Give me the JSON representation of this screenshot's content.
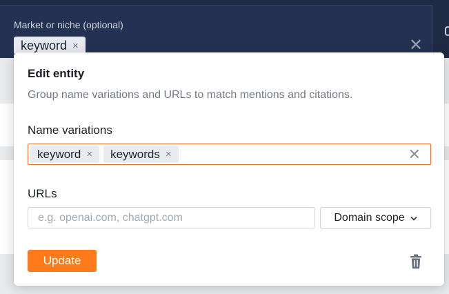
{
  "market": {
    "label": "Market or niche (optional)",
    "tags": [
      {
        "label": "keyword",
        "remove": "×"
      }
    ],
    "clear": "✕"
  },
  "modal": {
    "title": "Edit entity",
    "description": "Group name variations and URLs to match mentions and citations.",
    "name_variations": {
      "label": "Name variations",
      "tags": [
        {
          "label": "keyword",
          "remove": "×"
        },
        {
          "label": "keywords",
          "remove": "×"
        }
      ],
      "clear": "✕"
    },
    "urls": {
      "label": "URLs",
      "placeholder": "e.g. openai.com, chatgpt.com",
      "value": ""
    },
    "scope": {
      "label": "Domain scope",
      "chevron": "⌄"
    },
    "update_label": "Update",
    "icons": {
      "delete": "trash-icon",
      "chevron": "chevron-down-icon",
      "clear": "close-icon"
    },
    "colors": {
      "accent": "#ff7a1a",
      "focus_border": "#e36f2e",
      "header_bg": "#253152"
    }
  }
}
